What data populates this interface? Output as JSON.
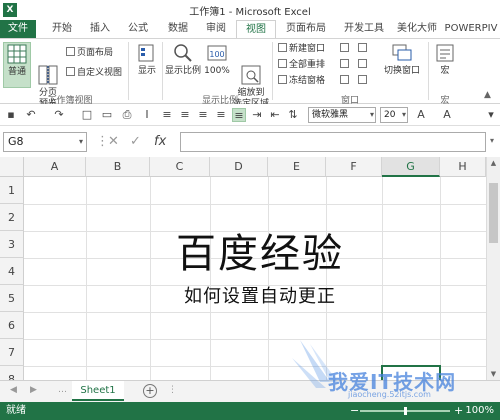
{
  "window": {
    "title": "工作簿1 - Microsoft Excel",
    "logo": "X"
  },
  "tabs": [
    {
      "label": "文件",
      "id": "file"
    },
    {
      "label": "开始",
      "id": "home"
    },
    {
      "label": "插入",
      "id": "insert"
    },
    {
      "label": "公式",
      "id": "formulas"
    },
    {
      "label": "数据",
      "id": "data"
    },
    {
      "label": "审阅",
      "id": "review"
    },
    {
      "label": "视图",
      "id": "view",
      "active": true
    },
    {
      "label": "页面布局",
      "id": "pagelayout"
    },
    {
      "label": "开发工具",
      "id": "developer"
    },
    {
      "label": "美化大师",
      "id": "beautify"
    },
    {
      "label": "POWERPIV",
      "id": "powerpivot"
    }
  ],
  "ribbon": {
    "workbook_views": {
      "label": "工作簿视图",
      "normal": "普通",
      "page_break_preview": "分页\n预览",
      "page_layout": "页面布局",
      "custom_views": "自定义视图"
    },
    "show": {
      "label": "显示"
    },
    "zoom": {
      "label": "显示比例",
      "zoom": "显示比例",
      "hundred": "100%",
      "zoom_to_selection": "缩放到\n选定区域"
    },
    "window": {
      "label": "窗口",
      "new_window": "新建窗口",
      "arrange_all": "全部重排",
      "freeze_panes": "冻结窗格",
      "switch_windows": "切换窗口"
    },
    "macros": {
      "label": "宏",
      "macros": "宏"
    }
  },
  "qat": {
    "font_name": "微软雅黑",
    "font_size": "20"
  },
  "formula_bar": {
    "name_box": "G8",
    "fx": "fx",
    "value": ""
  },
  "sheet": {
    "columns": [
      "A",
      "B",
      "C",
      "D",
      "E",
      "F",
      "G",
      "H"
    ],
    "selected_column": "G",
    "rows": [
      "1",
      "2",
      "3",
      "4",
      "5",
      "6",
      "7",
      "8"
    ],
    "title_text": "百度经验",
    "subtitle_text": "如何设置自动更正"
  },
  "sheet_tabs": {
    "active": "Sheet1",
    "add": "+"
  },
  "status": {
    "ready": "就绪",
    "zoom": "100%",
    "zoom_level_percent": 100
  },
  "watermark": {
    "text": "我爱IT技术网",
    "url": "jiaocheng.52itjs.com"
  },
  "colors": {
    "accent": "#217346",
    "selected_button": "#c5e0c9"
  }
}
